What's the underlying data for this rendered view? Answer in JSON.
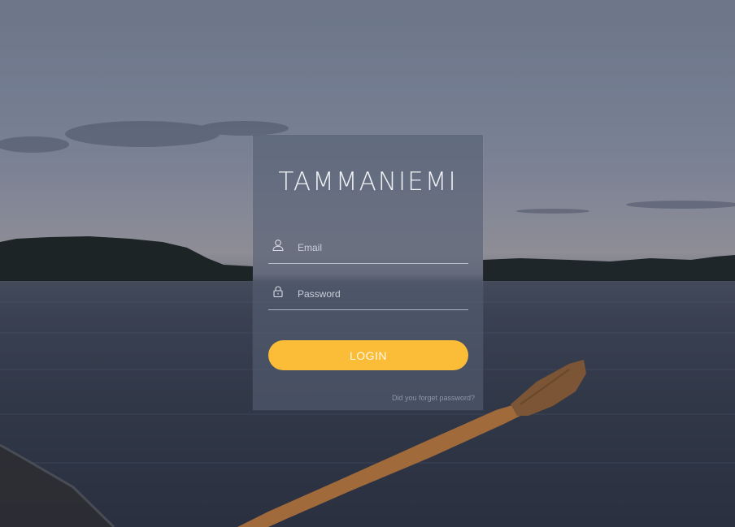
{
  "brand": {
    "title": "TAMMANIEMI"
  },
  "form": {
    "email": {
      "value": "",
      "placeholder": "Email",
      "icon": "user-icon"
    },
    "password": {
      "value": "",
      "placeholder": "Password",
      "icon": "lock-icon"
    },
    "login_label": "LOGIN",
    "forgot_label": "Did you forget password?"
  },
  "colors": {
    "accent": "#fbbd38",
    "card_overlay": "#566072",
    "text_light": "#eef0f4"
  }
}
